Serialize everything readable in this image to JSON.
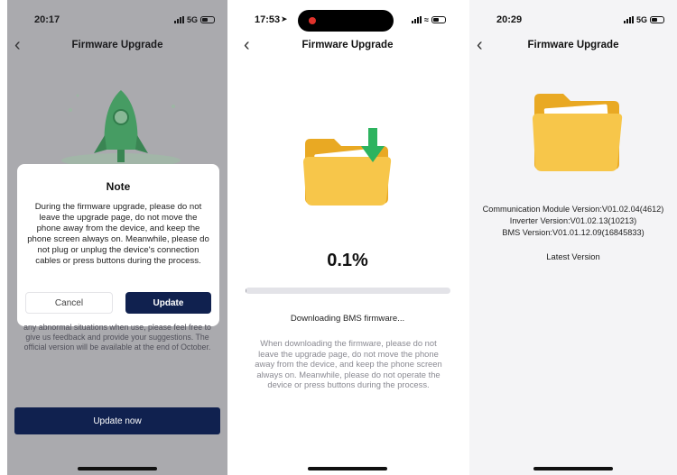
{
  "screens": [
    {
      "time": "20:17",
      "network": "5G",
      "title": "Firmware Upgrade",
      "dialog": {
        "title": "Note",
        "body": "During the firmware upgrade, please do not leave the upgrade page, do not move the phone away from the device, and keep the phone screen always on. Meanwhile, please do not plug or unplug the device's connection cables or press buttons during the process.",
        "cancel_label": "Cancel",
        "update_label": "Update"
      },
      "background_text": "any abnormal situations when use, please feel free to give us feedback and provide your suggestions. The official version will be available at the end of October.",
      "update_now_label": "Update now"
    },
    {
      "time": "17:53",
      "title": "Firmware Upgrade",
      "progress_text": "0.1%",
      "progress_value": 0.001,
      "status": "Downloading BMS firmware...",
      "hint": "When downloading the firmware, please do not leave the upgrade page, do not move the phone away from the device, and keep the phone screen always on. Meanwhile, please do not operate the device or press buttons during the process."
    },
    {
      "time": "20:29",
      "network": "5G",
      "title": "Firmware Upgrade",
      "versions": [
        "Communication Module Version:V01.02.04(4612)",
        "Inverter Version:V01.02.13(10213)",
        "BMS Version:V01.01.12.09(16845833)"
      ],
      "latest": "Latest Version"
    }
  ],
  "icons": {
    "back": "chevron-left-icon",
    "rocket": "rocket-icon",
    "folder_download": "folder-download-icon",
    "folder": "folder-icon"
  },
  "colors": {
    "primary_navy": "#10214f",
    "folder_yellow": "#f7c64a",
    "folder_dark": "#e9a923",
    "download_green": "#2db35f",
    "rocket_green": "#49b86c"
  }
}
